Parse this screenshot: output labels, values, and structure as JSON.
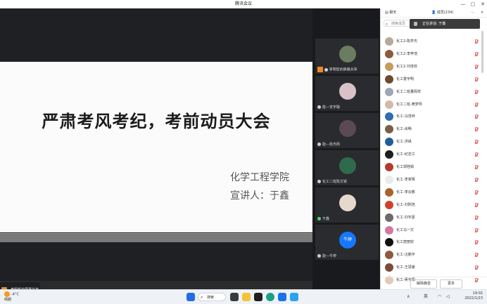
{
  "window": {
    "title": "腾讯会议",
    "controls": [
      "—",
      "▢",
      "✕"
    ]
  },
  "slide": {
    "headline": "严肃考风考纪，考前动员大会",
    "school": "化学工程学院",
    "presenter": "宣讲人：于鑫"
  },
  "sharing": {
    "top_label": "李明哲的屏幕共享",
    "bottom_label": "李明哲的屏幕共享"
  },
  "video_tiles": [
    {
      "label": "李明哲的屏幕共享",
      "avatar_color": "#6b7d60"
    },
    {
      "label": "能—安宇璇",
      "avatar_color": "#d8c2c8"
    },
    {
      "label": "能—张杰熙",
      "avatar_color": "#5a4a52"
    },
    {
      "label": "化工二班陈文锐",
      "avatar_color": "#2e6b4c"
    },
    {
      "label": "于鑫",
      "avatar_color": "#e7d8cc"
    },
    {
      "label": "能—牛婷",
      "avatar_text": "牛婷",
      "avatar_color": "#1677ff"
    }
  ],
  "panel": {
    "tab_chat": "聊天",
    "tab_members": "成员(234)",
    "tab_more": "···",
    "tab_close": "×",
    "search_placeholder": "搜索成员",
    "speaking": "正在讲话: 于鑫",
    "members": [
      {
        "name": "化工2-陈学杰",
        "color": "#b7a99a"
      },
      {
        "name": "化工2-李梓浩",
        "color": "#8c5b3e"
      },
      {
        "name": "化工2-刘佳欢",
        "color": "#c89b5a"
      },
      {
        "name": "化工曹宇明",
        "color": "#6f4a2f"
      },
      {
        "name": "化工二班董佩祥",
        "color": "#9fa7b5"
      },
      {
        "name": "化工二班-黄梦柯",
        "color": "#d3b9a9"
      },
      {
        "name": "化工-马茂林",
        "color": "#2f6cb3"
      },
      {
        "name": "化工-肖畅",
        "color": "#7c5d46"
      },
      {
        "name": "化工-洪缘",
        "color": "#1f5e9c"
      },
      {
        "name": "化工-纪志江",
        "color": "#1e1e1e"
      },
      {
        "name": "化工郭桂娟",
        "color": "#b33a2e"
      },
      {
        "name": "化工-李家辉",
        "color": "#eaeaea"
      },
      {
        "name": "化工-李云鹏",
        "color": "#a8632c"
      },
      {
        "name": "化工-刘刚浩",
        "color": "#d0432b"
      },
      {
        "name": "化工-刘宇嘉",
        "color": "#6a6a6a"
      },
      {
        "name": "化工马一文",
        "color": "#d07aa3"
      },
      {
        "name": "化工唐丽姣",
        "color": "#111111"
      },
      {
        "name": "化工-汪鹏宇",
        "color": "#8d5a3d"
      },
      {
        "name": "化工-王思媛",
        "color": "#7a4b3b"
      },
      {
        "name": "化工-吴宇阳",
        "color": "#e2c9b9"
      }
    ],
    "btn_mute_all": "解除静音",
    "btn_more": "更多"
  },
  "taskbar": {
    "weather_temp": "-4°C",
    "weather_desc": "晴朗",
    "search_label": "搜索",
    "tray_lang": "英",
    "time": "19:02",
    "date": "2022/1/23"
  }
}
